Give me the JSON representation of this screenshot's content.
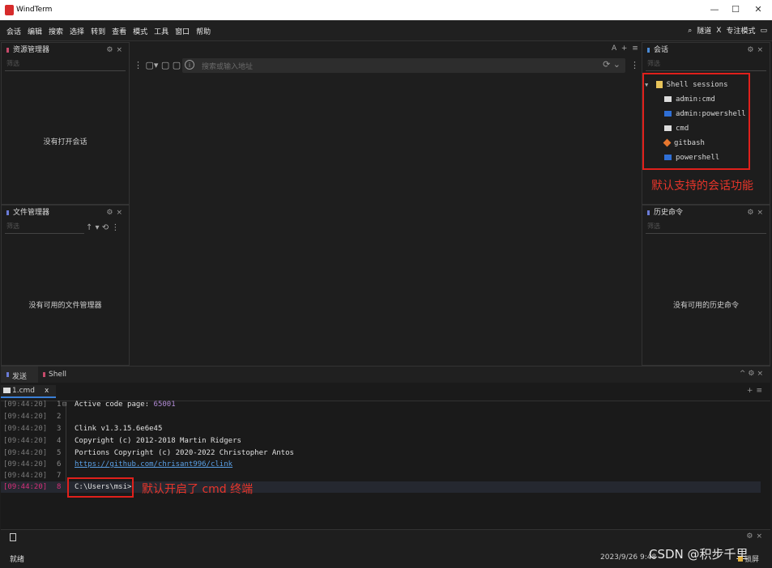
{
  "window": {
    "title": "WindTerm",
    "controls": [
      "—",
      "☐",
      "✕"
    ]
  },
  "menu": {
    "items": [
      "会话",
      "编辑",
      "搜索",
      "选择",
      "转到",
      "查看",
      "模式",
      "工具",
      "窗口",
      "帮助"
    ],
    "right": {
      "search": "⌕",
      "tunnel": "隧道",
      "x": "X",
      "focus": "专注模式",
      "layout": "▭"
    }
  },
  "explorer": {
    "title": "资源管理器",
    "filter": "筛选",
    "empty": "没有打开会话"
  },
  "filemanager": {
    "title": "文件管理器",
    "filter": "筛选",
    "empty": "没有可用的文件管理器"
  },
  "toolbar": {
    "address_placeholder": "搜索或输入地址",
    "font_a": "A",
    "plus": "+",
    "menu": "≡"
  },
  "sessions": {
    "title": "会话",
    "filter": "筛选",
    "group": "Shell sessions",
    "items": [
      "admin:cmd",
      "admin:powershell",
      "cmd",
      "gitbash",
      "powershell"
    ],
    "annotation": "默认支持的会话功能"
  },
  "history": {
    "title": "历史命令",
    "filter": "筛选",
    "empty": "没有可用的历史命令"
  },
  "bottom_tabs": {
    "send": "发送",
    "shell": "Shell"
  },
  "terminal": {
    "tab": "1.cmd",
    "tab_close": "x",
    "lines": [
      {
        "ts": "[09:44:20]",
        "n": "1",
        "text": "Active code page: ",
        "extra": "65001"
      },
      {
        "ts": "[09:44:20]",
        "n": "2",
        "text": ""
      },
      {
        "ts": "[09:44:20]",
        "n": "3",
        "text": "Clink v1.3.15.6e6e45"
      },
      {
        "ts": "[09:44:20]",
        "n": "4",
        "text": "Copyright (c) 2012-2018 Martin Ridgers"
      },
      {
        "ts": "[09:44:20]",
        "n": "5",
        "text": "Portions Copyright (c) 2020-2022 Christopher Antos"
      },
      {
        "ts": "[09:44:20]",
        "n": "6",
        "text": "https://github.com/chrisant996/clink"
      },
      {
        "ts": "[09:44:20]",
        "n": "7",
        "text": ""
      },
      {
        "ts": "[09:44:20]",
        "n": "8",
        "text": "C:\\Users\\msi>"
      }
    ],
    "annotation": "默认开启了 cmd 终端"
  },
  "status": {
    "left": "就绪",
    "datetime": "2023/9/26 9:48",
    "watermark": "CSDN @积步千里",
    "right": "锁屏"
  }
}
